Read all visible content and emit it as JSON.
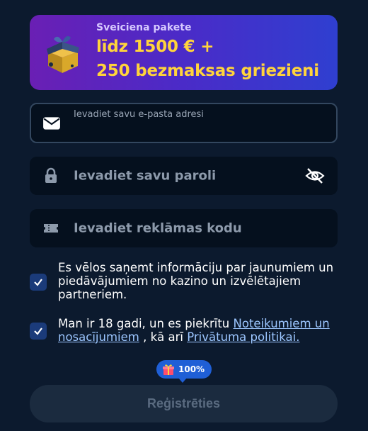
{
  "promo": {
    "title": "Sveiciena pakete",
    "line1": "līdz 1500 € +",
    "line2": "250 bezmaksas griezieni"
  },
  "email": {
    "label": "Ievadiet savu e-pasta adresi"
  },
  "password": {
    "placeholder": "Ievadiet savu paroli"
  },
  "promo_code": {
    "placeholder": "Ievadiet reklāmas kodu"
  },
  "consents": {
    "marketing": {
      "text": "Es vēlos saņemt informāciju par jaunumiem un piedāvājumiem no kazino un izvēlētajiem partneriem.",
      "checked": true
    },
    "terms": {
      "text_before": "Man ir 18 gadi, un es piekrītu ",
      "terms_link": "Noteikumiem un nosacījumiem",
      "text_middle": " , kā arī ",
      "privacy_link": "Privātuma politikai.",
      "checked": true
    }
  },
  "progress_badge": {
    "label": "100%"
  },
  "register_button": {
    "label": "Reģistrēties"
  },
  "colors": {
    "background": "#0c1a2e",
    "field": "#05101e",
    "promo_accent": "#ffd43b",
    "checkbox": "#1b3b7a",
    "badge": "#1f5fd6",
    "button_disabled": "#1b2b3f"
  }
}
